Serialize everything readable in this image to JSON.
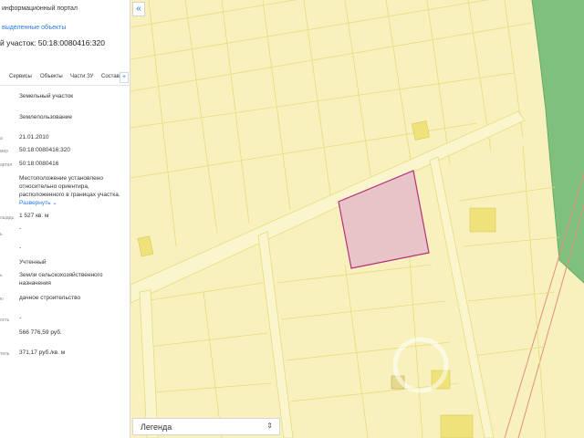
{
  "panel": {
    "portal_title": "информационный портал",
    "selected_link": "выделенные объекты",
    "parcel_title": "й участок: 50:18:0080416:320",
    "tabs": [
      "Сервисы",
      "Объекты",
      "Части ЗУ",
      "Состав"
    ],
    "tab_plus": "+",
    "rows": [
      {
        "label": "",
        "value": "Земельный участок"
      },
      {
        "label": "",
        "value": "Землепользование"
      },
      {
        "label": "а",
        "value": "21.01.2010"
      },
      {
        "label": "мер",
        "value": "50:18:0080416:320"
      },
      {
        "label": "артал",
        "value": "50:18:0080416"
      },
      {
        "label": "",
        "value": "Местоположение установлено относительно ориентира, расположенного в границах участка."
      },
      {
        "label": "ощадь",
        "value": "1 527 кв. м"
      },
      {
        "label": "ь",
        "value": "-"
      },
      {
        "label": "",
        "value": "-"
      },
      {
        "label": "",
        "value": "Учтенный"
      },
      {
        "label": "ь",
        "value": "Земли сельскохозяйственного назначения"
      },
      {
        "label": "ю",
        "value": "дачное строительство"
      },
      {
        "label": "ость",
        "value": "-"
      },
      {
        "label": "",
        "value": "566 776,59 руб."
      },
      {
        "label": "тель",
        "value": "371,17 руб./кв. м"
      }
    ],
    "expand_label": "Развернуть"
  },
  "map": {
    "collapse_icon": "«",
    "legend_label": "Легенда",
    "legend_arrow": "⇕",
    "land_color": "#f8f1bd",
    "road_color": "#fbf5cd",
    "parcel_line_color": "#e6dc7c",
    "selected_fill": "#e8c3c8",
    "selected_stroke": "#b5307c",
    "building_color": "#efe27a",
    "forest_color": "#7fc17c",
    "boundary_color": "#e58d7f"
  }
}
